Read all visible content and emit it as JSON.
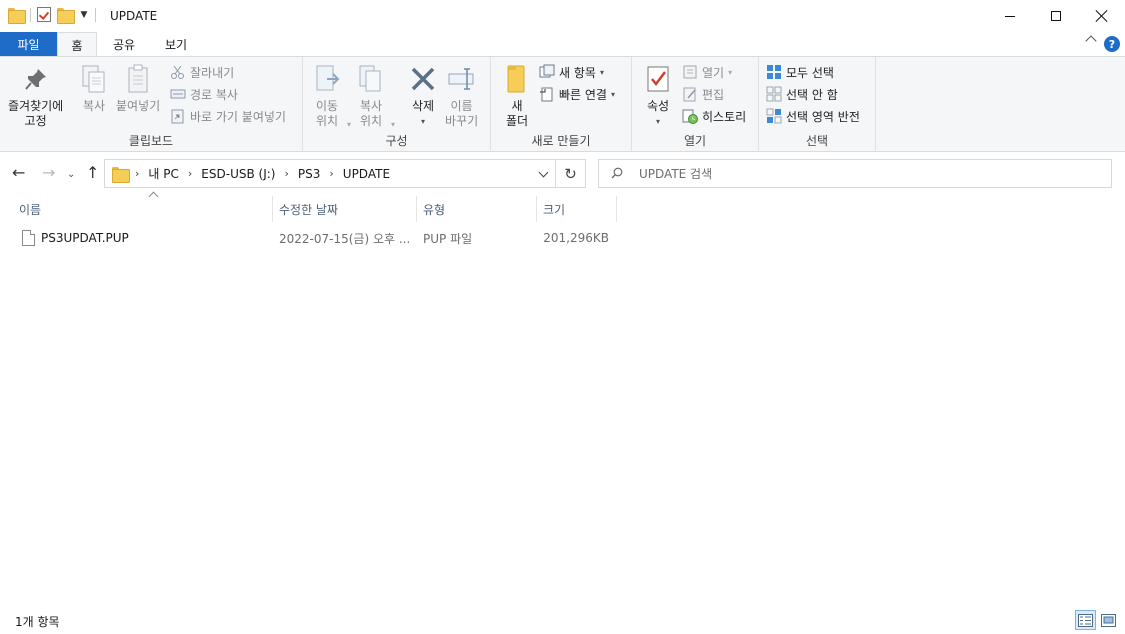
{
  "window": {
    "title": "UPDATE"
  },
  "ribbon_tabs": [
    {
      "label": "파일"
    },
    {
      "label": "홈"
    },
    {
      "label": "공유"
    },
    {
      "label": "보기"
    }
  ],
  "clipboard": {
    "group_label": "클립보드",
    "pin": "즐겨찾기에\n고정",
    "copy": "복사",
    "paste": "붙여넣기",
    "cut": "잘라내기",
    "copy_path": "경로 복사",
    "paste_shortcut": "바로 가기 붙여넣기"
  },
  "organize": {
    "group_label": "구성",
    "move_to": "이동\n위치",
    "copy_to": "복사\n위치",
    "delete": "삭제",
    "rename": "이름\n바꾸기"
  },
  "new": {
    "group_label": "새로 만들기",
    "new_folder": "새\n폴더",
    "new_item": "새 항목",
    "easy_access": "빠른 연결"
  },
  "open": {
    "group_label": "열기",
    "properties": "속성",
    "open": "열기",
    "edit": "편집",
    "history": "히스토리"
  },
  "select": {
    "group_label": "선택",
    "select_all": "모두 선택",
    "select_none": "선택 안 함",
    "invert": "선택 영역 반전"
  },
  "address": {
    "crumbs": [
      "내 PC",
      "ESD-USB (J:)",
      "PS3",
      "UPDATE"
    ]
  },
  "search": {
    "placeholder": "UPDATE 검색"
  },
  "columns": {
    "name": "이름",
    "modified": "수정한 날짜",
    "type": "유형",
    "size": "크기"
  },
  "files": [
    {
      "name": "PS3UPDAT.PUP",
      "modified": "2022-07-15(금) 오후 ...",
      "type": "PUP 파일",
      "size": "201,296KB"
    }
  ],
  "status": {
    "item_count": "1개 항목"
  },
  "colors": {
    "accent": "#1e6cc8",
    "folder": "#f6cd57",
    "ribbon_bg": "#f5f6f7",
    "header_text": "#4c607a"
  }
}
